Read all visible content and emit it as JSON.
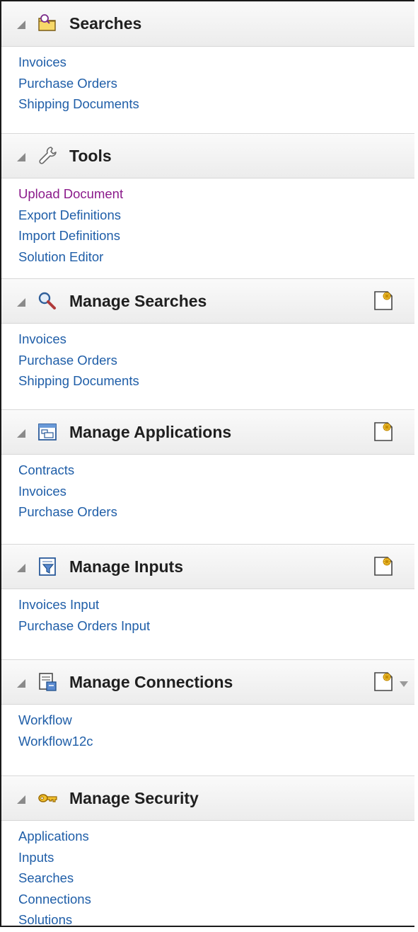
{
  "sections": [
    {
      "title": "Searches",
      "icon": "folder-search-icon",
      "links": [
        {
          "label": "Invoices"
        },
        {
          "label": "Purchase Orders"
        },
        {
          "label": "Shipping Documents"
        }
      ]
    },
    {
      "title": "Tools",
      "icon": "wrench-icon",
      "links": [
        {
          "label": "Upload Document",
          "visited": true
        },
        {
          "label": "Export Definitions"
        },
        {
          "label": "Import Definitions"
        },
        {
          "label": "Solution Editor"
        }
      ]
    },
    {
      "title": "Manage Searches",
      "icon": "magnifier-icon",
      "links": [
        {
          "label": "Invoices"
        },
        {
          "label": "Purchase Orders"
        },
        {
          "label": "Shipping Documents"
        }
      ]
    },
    {
      "title": "Manage Applications",
      "icon": "application-window-icon",
      "links": [
        {
          "label": "Contracts"
        },
        {
          "label": "Invoices"
        },
        {
          "label": "Purchase Orders"
        }
      ]
    },
    {
      "title": "Manage Inputs",
      "icon": "input-filter-icon",
      "links": [
        {
          "label": "Invoices Input"
        },
        {
          "label": "Purchase Orders Input"
        }
      ]
    },
    {
      "title": "Manage Connections",
      "icon": "connection-icon",
      "links": [
        {
          "label": "Workflow"
        },
        {
          "label": "Workflow12c"
        }
      ]
    },
    {
      "title": "Manage Security",
      "icon": "key-icon",
      "links": [
        {
          "label": "Applications"
        },
        {
          "label": "Inputs"
        },
        {
          "label": "Searches"
        },
        {
          "label": "Connections"
        },
        {
          "label": "Solutions"
        }
      ]
    }
  ],
  "colors": {
    "link": "#1f5ea8",
    "visited_link": "#8b1b8b",
    "header_text": "#1f1f1f"
  }
}
